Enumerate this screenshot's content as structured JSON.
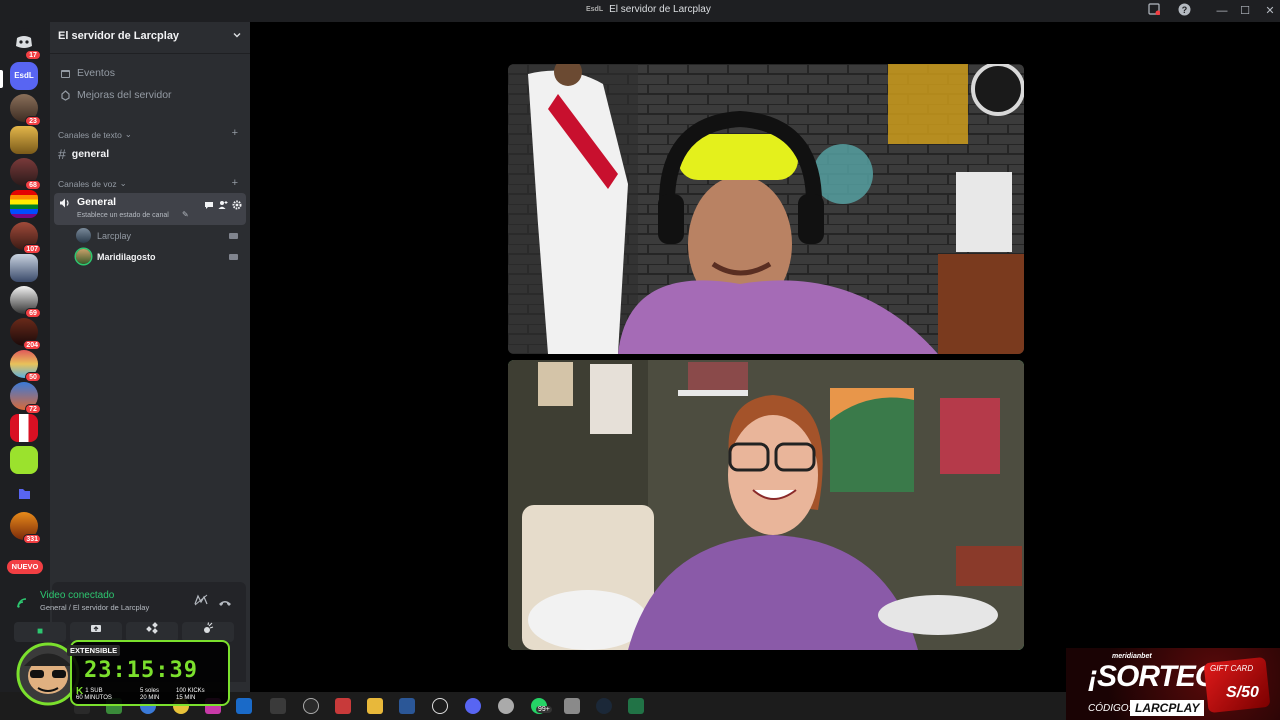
{
  "window": {
    "title": "El servidor de Larcplay",
    "title_logo": "EsdL",
    "controls": [
      "—",
      "☐",
      "✕"
    ]
  },
  "rail": {
    "home_badge": "17",
    "server_badges": [
      "23",
      "68",
      "107",
      "69",
      "204",
      "50",
      "72",
      "331"
    ],
    "current_server": "EsdL",
    "new_label": "NUEVO"
  },
  "sidebar": {
    "server_name": "El servidor de Larcplay",
    "nav": [
      {
        "label": "Eventos",
        "icon": "calendar-icon"
      },
      {
        "label": "Mejoras del servidor",
        "icon": "boost-icon"
      }
    ],
    "text_category": "Canales de texto",
    "text_channel": "general",
    "voice_category": "Canales de voz",
    "voice_channel": {
      "name": "General",
      "status": "Establece un estado de canal"
    },
    "voice_users": [
      {
        "name": "Larcplay",
        "active": false
      },
      {
        "name": "Maridilagosto",
        "active": true
      }
    ]
  },
  "voice_panel": {
    "status": "Video conectado",
    "location": "General / El servidor de Larcplay"
  },
  "overlay_timer": {
    "label": "EXTENSIBLE",
    "time": "23:15:39",
    "stats": [
      {
        "top": "1 SUB",
        "bottom": "60 MINUTOS"
      },
      {
        "top": "5 soles",
        "bottom": "20 MIN"
      },
      {
        "top": "100 KICKs",
        "bottom": "15 MIN"
      }
    ]
  },
  "overlay_promo": {
    "brand": "meridianbet",
    "headline": "¡SORTEO!",
    "code_label": "CÓDIGO:",
    "code": "LARCPLAY",
    "card_title": "GIFT CARD",
    "card_value": "S/50"
  },
  "taskbar": {
    "badge": "99+"
  },
  "colors": {
    "accent_green": "#2dc770",
    "badge_red": "#f23f43",
    "sidebar_bg": "#2b2d31",
    "rail_bg": "#1e1f22"
  }
}
